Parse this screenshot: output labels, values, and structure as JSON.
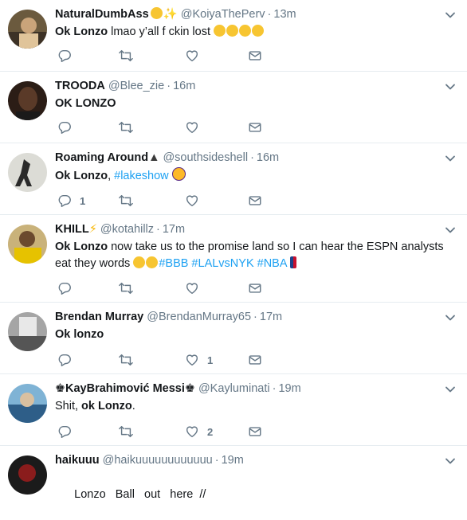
{
  "tweets": [
    {
      "name": "NaturalDumbAss",
      "handle": "@KoiyaThePerv",
      "time": "13m",
      "text_bold": "Ok Lonzo",
      "text": " lmao y’all f  ckin lost ",
      "tags": "",
      "replies": "",
      "retweets": "",
      "likes": ""
    },
    {
      "name": "TROODA",
      "handle": "@Blee_zie",
      "time": "16m",
      "text_bold": "OK LONZO",
      "text": "",
      "tags": "",
      "replies": "",
      "retweets": "",
      "likes": ""
    },
    {
      "name": "Roaming Around",
      "handle": "@southsideshell",
      "time": "16m",
      "text_bold": "Ok Lonzo",
      "text": ", ",
      "tags": "#lakeshow",
      "replies": "1",
      "retweets": "",
      "likes": ""
    },
    {
      "name": "KHILL",
      "handle": "@kotahillz",
      "time": "17m",
      "text_bold": "Ok Lonzo",
      "text": " now take us to the promise land so I can hear the ESPN analysts eat they words ",
      "tags": "#BBB #LALvsNYK #NBA",
      "replies": "",
      "retweets": "",
      "likes": ""
    },
    {
      "name": "Brendan Murray",
      "handle": "@BrendanMurray65",
      "time": "17m",
      "text_bold": "Ok lonzo",
      "text": "",
      "tags": "",
      "replies": "",
      "retweets": "",
      "likes": "1"
    },
    {
      "name": "KayBrahimović Messi",
      "handle": "@Kayluminati",
      "time": "19m",
      "text_pre": "Shit, ",
      "text_bold": "ok Lonzo",
      "text": ".",
      "tags": "",
      "replies": "",
      "retweets": "",
      "likes": "2"
    },
    {
      "name": "haikuuu",
      "handle": "@haikuuuuuuuuuuuu",
      "time": "19m",
      "text_plain": "Lonzo   Ball   out   here  //",
      "replies": "",
      "retweets": "",
      "likes": ""
    }
  ],
  "separator": "·",
  "colors": {
    "accent": "#1da1f2",
    "muted": "#657786",
    "divider": "#e6ecf0"
  },
  "icons": [
    "reply-icon",
    "retweet-icon",
    "like-icon",
    "message-icon",
    "chevron-down-icon"
  ]
}
